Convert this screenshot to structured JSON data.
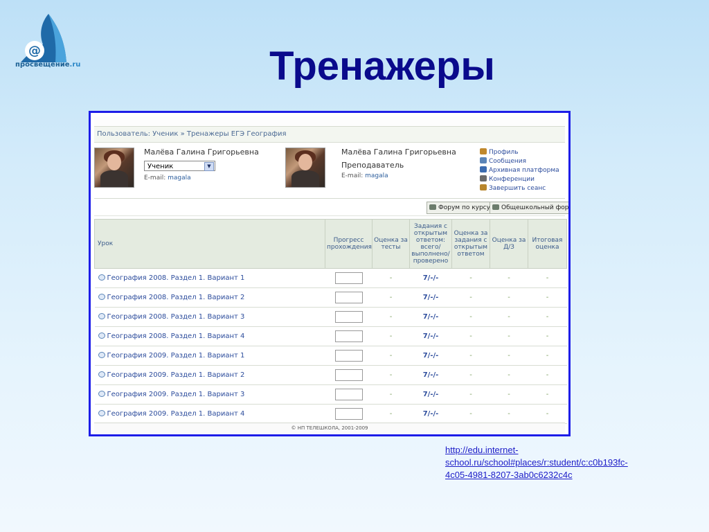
{
  "logo": {
    "text": "просвещение",
    "suffix": ".ru"
  },
  "slide_title": "Тренажеры",
  "breadcrumb": {
    "prefix": "Пользователь: Ученик » ",
    "current": "Тренажеры ЕГЭ География"
  },
  "student": {
    "name": "Малёва Галина Григорьевна",
    "role_select": "Ученик",
    "email_label": "E-mail:",
    "email_value": "magala"
  },
  "teacher": {
    "name": "Малёва Галина Григорьевна",
    "role": "Преподаватель",
    "email_label": "E-mail:",
    "email_value": "magala"
  },
  "menu_links": [
    {
      "label": "Профиль",
      "icon": "user-icon",
      "color": "#c0882c"
    },
    {
      "label": "Сообщения",
      "icon": "envelope-icon",
      "color": "#5b85b8"
    },
    {
      "label": "Архивная платформа",
      "icon": "archive-icon",
      "color": "#3c6cb0"
    },
    {
      "label": "Конференции",
      "icon": "conference-icon",
      "color": "#6b6b6b"
    },
    {
      "label": "Завершить сеанс",
      "icon": "exit-icon",
      "color": "#b8862c"
    }
  ],
  "toolbar": {
    "course_forum": "Форум по курсу",
    "school_forum": "Общешкольный форум"
  },
  "table": {
    "headers": [
      "Урок",
      "Прогресс прохождения",
      "Оценка за тесты",
      "Задания с открытым ответом: всего/ выполнено/ проверено",
      "Оценка за задания с открытым ответом",
      "Оценка за Д/З",
      "Итоговая оценка"
    ],
    "rows": [
      {
        "lesson": "География 2008. Раздел 1. Вариант 1",
        "test": "-",
        "open": "7/-/-",
        "open_grade": "-",
        "hw": "-",
        "final": "-"
      },
      {
        "lesson": "География 2008. Раздел 1. Вариант 2",
        "test": "-",
        "open": "7/-/-",
        "open_grade": "-",
        "hw": "-",
        "final": "-"
      },
      {
        "lesson": "География 2008. Раздел 1. Вариант 3",
        "test": "-",
        "open": "7/-/-",
        "open_grade": "-",
        "hw": "-",
        "final": "-"
      },
      {
        "lesson": "География 2008. Раздел 1. Вариант 4",
        "test": "-",
        "open": "7/-/-",
        "open_grade": "-",
        "hw": "-",
        "final": "-"
      },
      {
        "lesson": "География 2009. Раздел 1. Вариант 1",
        "test": "-",
        "open": "7/-/-",
        "open_grade": "-",
        "hw": "-",
        "final": "-"
      },
      {
        "lesson": "География 2009. Раздел 1. Вариант 2",
        "test": "-",
        "open": "7/-/-",
        "open_grade": "-",
        "hw": "-",
        "final": "-"
      },
      {
        "lesson": "География 2009. Раздел 1. Вариант 3",
        "test": "-",
        "open": "7/-/-",
        "open_grade": "-",
        "hw": "-",
        "final": "-"
      },
      {
        "lesson": "География 2009. Раздел 1. Вариант 4",
        "test": "-",
        "open": "7/-/-",
        "open_grade": "-",
        "hw": "-",
        "final": "-"
      }
    ]
  },
  "footer": "© НП ТЕЛЕШКОЛА, 2001-2009",
  "source_url": "http://edu.internet-school.ru/school#places/r:student/c:c0b193fc-4c05-4981-8207-3ab0c6232c4c"
}
